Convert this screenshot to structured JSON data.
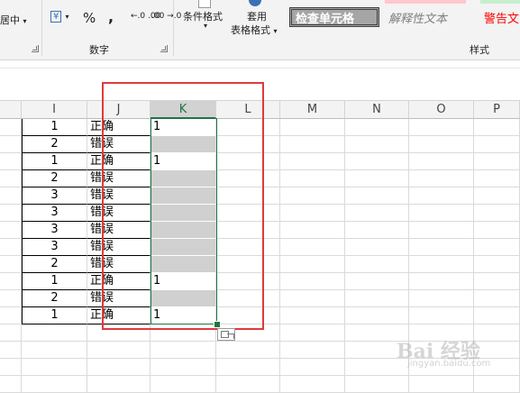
{
  "ribbon": {
    "merge_label": "居中",
    "number_group_label": "数字",
    "currency_symbol": "¥",
    "percent_label": "%",
    "comma_label": ",",
    "inc_decimal": "←.0 .00",
    "dec_decimal": ".00 →.0",
    "cond_format": "条件格式",
    "table_format_line1": "套用",
    "table_format_line2": "表格格式",
    "styles_group_label": "样式",
    "style_check_cell": "检查单元格",
    "style_explanatory": "解释性文本",
    "style_warning": "警告文"
  },
  "columns": [
    "I",
    "J",
    "K",
    "L",
    "M",
    "N",
    "O",
    "P"
  ],
  "rows": [
    {
      "i": "1",
      "j": "正确",
      "k": "1"
    },
    {
      "i": "2",
      "j": "错误",
      "k": ""
    },
    {
      "i": "1",
      "j": "正确",
      "k": "1"
    },
    {
      "i": "2",
      "j": "错误",
      "k": ""
    },
    {
      "i": "3",
      "j": "错误",
      "k": ""
    },
    {
      "i": "3",
      "j": "错误",
      "k": ""
    },
    {
      "i": "3",
      "j": "错误",
      "k": ""
    },
    {
      "i": "3",
      "j": "错误",
      "k": ""
    },
    {
      "i": "2",
      "j": "错误",
      "k": ""
    },
    {
      "i": "1",
      "j": "正确",
      "k": "1"
    },
    {
      "i": "2",
      "j": "错误",
      "k": ""
    },
    {
      "i": "1",
      "j": "正确",
      "k": "1"
    }
  ],
  "colors": {
    "accent_green": "#217346",
    "highlight_red": "#e03a3a",
    "gray_fill": "#d0d0d0"
  },
  "watermark": {
    "logo": "Bai 经验",
    "url": "jingyan.baidu.com"
  }
}
